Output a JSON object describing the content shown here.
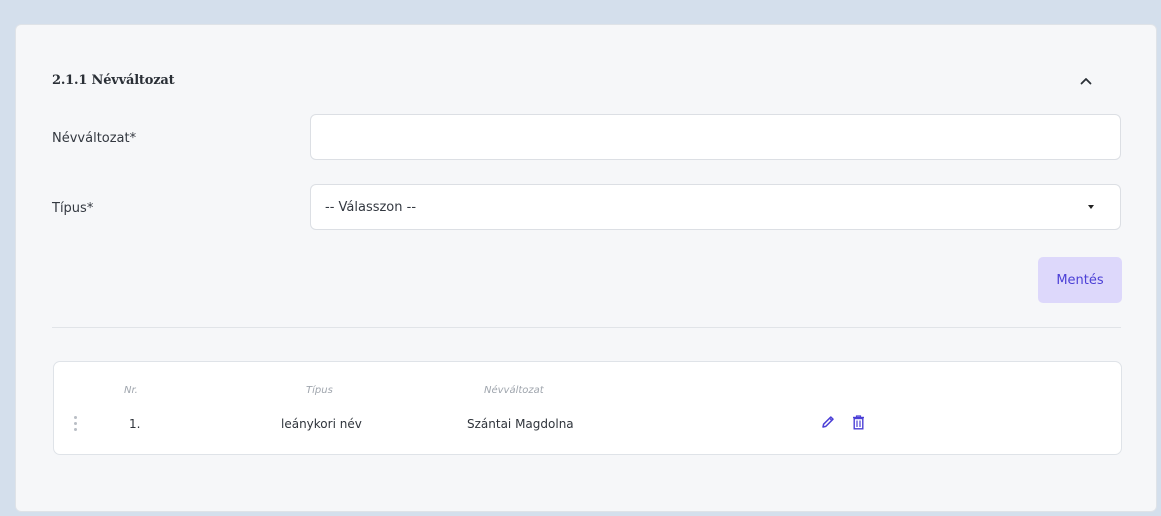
{
  "section": {
    "title": "2.1.1 Névváltozat",
    "collapse_icon": "chevron-up-icon"
  },
  "form": {
    "name_variant": {
      "label": "Névváltozat*",
      "value": "",
      "placeholder": ""
    },
    "type": {
      "label": "Típus*",
      "selected": "-- Válasszon --"
    },
    "save_label": "Mentés"
  },
  "table": {
    "headers": {
      "nr": "Nr.",
      "type": "Típus",
      "name_variant": "Névváltozat"
    },
    "rows": [
      {
        "nr": "1.",
        "type": "leánykori név",
        "name_variant": "Szántai Magdolna",
        "actions": [
          "pencil-icon",
          "trash-icon"
        ]
      }
    ]
  },
  "colors": {
    "accent": "#4b3fd6",
    "button_bg": "#ddd8fb",
    "page_bg": "#d4dfec",
    "panel_bg": "#f6f7f9"
  }
}
